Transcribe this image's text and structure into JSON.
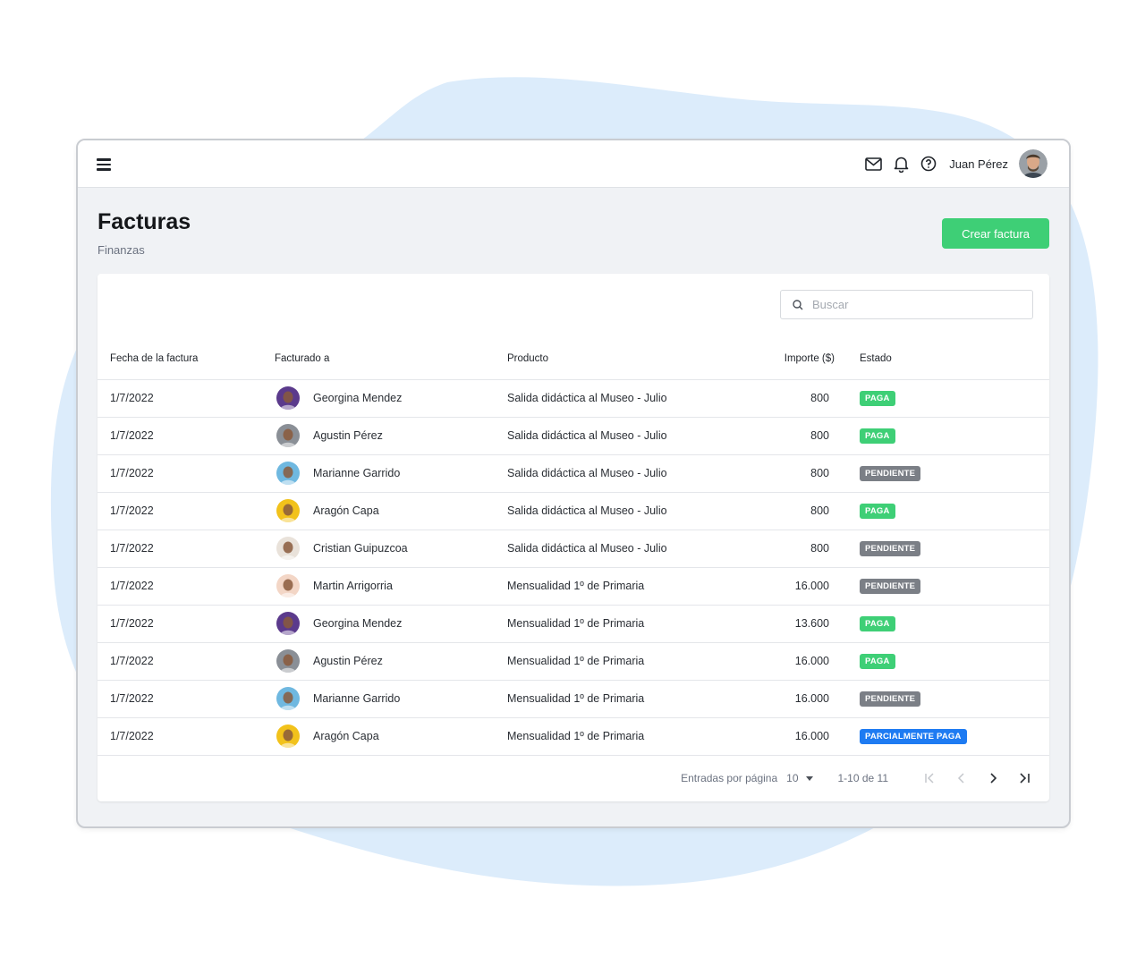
{
  "header": {
    "user_name": "Juan Pérez",
    "icons": [
      "menu-icon",
      "mail-icon",
      "bell-icon",
      "help-icon"
    ]
  },
  "page": {
    "title": "Facturas",
    "breadcrumb": "Finanzas",
    "create_button": "Crear factura"
  },
  "search": {
    "placeholder": "Buscar",
    "value": ""
  },
  "table": {
    "columns": [
      "Fecha de la factura",
      "Facturado a",
      "Producto",
      "Importe ($)",
      "Estado"
    ],
    "rows": [
      {
        "date": "1/7/2022",
        "name": "Georgina Mendez",
        "product": "Salida didáctica al Museo - Julio",
        "amount": "800",
        "status": "PAGA"
      },
      {
        "date": "1/7/2022",
        "name": "Agustin Pérez",
        "product": "Salida didáctica al Museo - Julio",
        "amount": "800",
        "status": "PAGA"
      },
      {
        "date": "1/7/2022",
        "name": "Marianne Garrido",
        "product": "Salida didáctica al Museo - Julio",
        "amount": "800",
        "status": "PENDIENTE"
      },
      {
        "date": "1/7/2022",
        "name": "Aragón Capa",
        "product": "Salida didáctica al Museo - Julio",
        "amount": "800",
        "status": "PAGA"
      },
      {
        "date": "1/7/2022",
        "name": "Cristian Guipuzcoa",
        "product": "Salida didáctica al Museo - Julio",
        "amount": "800",
        "status": "PENDIENTE"
      },
      {
        "date": "1/7/2022",
        "name": "Martin Arrigorria",
        "product": "Mensualidad 1º de Primaria",
        "amount": "16.000",
        "status": "PENDIENTE"
      },
      {
        "date": "1/7/2022",
        "name": "Georgina Mendez",
        "product": "Mensualidad 1º de Primaria",
        "amount": "13.600",
        "status": "PAGA"
      },
      {
        "date": "1/7/2022",
        "name": "Agustin Pérez",
        "product": "Mensualidad 1º de Primaria",
        "amount": "16.000",
        "status": "PAGA"
      },
      {
        "date": "1/7/2022",
        "name": "Marianne Garrido",
        "product": "Mensualidad 1º de Primaria",
        "amount": "16.000",
        "status": "PENDIENTE"
      },
      {
        "date": "1/7/2022",
        "name": "Aragón Capa",
        "product": "Mensualidad 1º de Primaria",
        "amount": "16.000",
        "status": "PARCIALMENTE PAGA"
      }
    ]
  },
  "status_colors": {
    "PAGA": "#3ecf76",
    "PENDIENTE": "#7b7f86",
    "PARCIALMENTE PAGA": "#1e7bf2"
  },
  "avatar_colors": [
    "#5b3a8c",
    "#8a8f96",
    "#6fb8e0",
    "#f2c21b",
    "#e9e2da",
    "#f3d6c6",
    "#5b3a8c",
    "#8a8f96",
    "#6fb8e0",
    "#f2c21b"
  ],
  "pagination": {
    "rows_per_page_label": "Entradas por página",
    "rows_per_page": "10",
    "range": "1-10 de 11"
  },
  "colors": {
    "accent": "#3ecf76",
    "blob": "#dcecfb"
  }
}
